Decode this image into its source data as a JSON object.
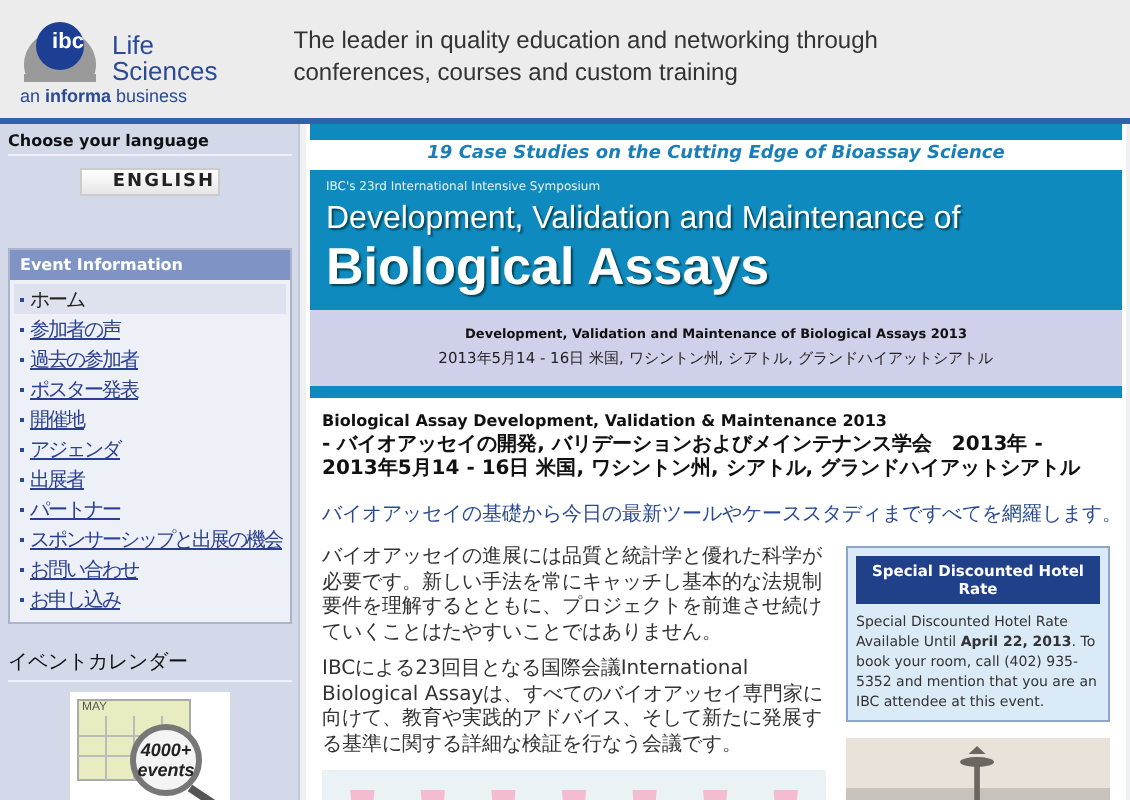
{
  "header": {
    "logo": {
      "mark": "ibc",
      "name_line_1": "Life",
      "name_line_2": "Sciences",
      "tagline": "an **informa** business"
    },
    "slogan_line_1": "The leader in quality education and networking through",
    "slogan_line_2": "conferences, courses and custom training"
  },
  "sidebar": {
    "language": {
      "title": "Choose your language",
      "button": "ENGLISH"
    },
    "event_info": {
      "title": "Event Information",
      "items": [
        {
          "label": "ホーム",
          "selected": true
        },
        {
          "label": "参加者の声",
          "selected": false
        },
        {
          "label": "過去の参加者",
          "selected": false
        },
        {
          "label": "ポスター発表",
          "selected": false
        },
        {
          "label": "開催地",
          "selected": false
        },
        {
          "label": "アジェンダ",
          "selected": false
        },
        {
          "label": "出展者",
          "selected": false
        },
        {
          "label": "パートナー",
          "selected": false
        },
        {
          "label": "スポンサーシップと出展の機会",
          "selected": false
        },
        {
          "label": "お問い合わせ",
          "selected": false
        },
        {
          "label": "お申し込み",
          "selected": false
        }
      ]
    },
    "calendar": {
      "title": "イベントカレンダー",
      "banner": {
        "month": "MAY",
        "count": "4000+",
        "word": "events"
      }
    }
  },
  "main": {
    "case_studies": "19 Case Studies on the Cutting Edge of Bioassay Science",
    "banner": {
      "kicker": "IBC's 23rd International Intensive Symposium",
      "title_line_1": "Development, Validation and Maintenance of",
      "title_line_2": "Biological Assays"
    },
    "event_bar": {
      "name": "Development, Validation and Maintenance of Biological Assays 2013",
      "details": "2013年5月14 - 16日 米国, ワシントン州, シアトル, グランドハイアットシアトル"
    },
    "heading": [
      "Biological Assay Development, Validation & Maintenance 2013",
      "- バイオアッセイの開発, バリデーションおよびメインテナンス学会　2013年 -",
      "2013年5月14 - 16日 米国, ワシントン州, シアトル, グランドハイアットシアトル"
    ],
    "tagline": "バイオアッセイの基礎から今日の最新ツールやケーススタディまですべてを網羅します。",
    "paragraphs": [
      "バイオアッセイの進展には品質と統計学と優れた科学が必要です。新しい手法を常にキャッチし基本的な法規制要件を理解するとともに、プロジェクトを前進させ続けていくことはたやすいことではありません。",
      "IBCによる23回目となる国際会議International Biological Assayは、すべてのバイオアッセイ専門家に向けて、教育や実践的アドバイス、そして新たに発展する基準に関する詳細な検証を行なう会議です。"
    ],
    "image": {
      "kind": "picture"
    },
    "hotel": {
      "title": "Special Discounted Hotel Rate",
      "text": "Special Discounted Hotel Rate Available Until **April 22, 2013**. To book your room, call (402) 935-5352 and mention that you are an IBC attendee at this event.",
      "image": {
        "kind": "picture"
      }
    }
  }
}
